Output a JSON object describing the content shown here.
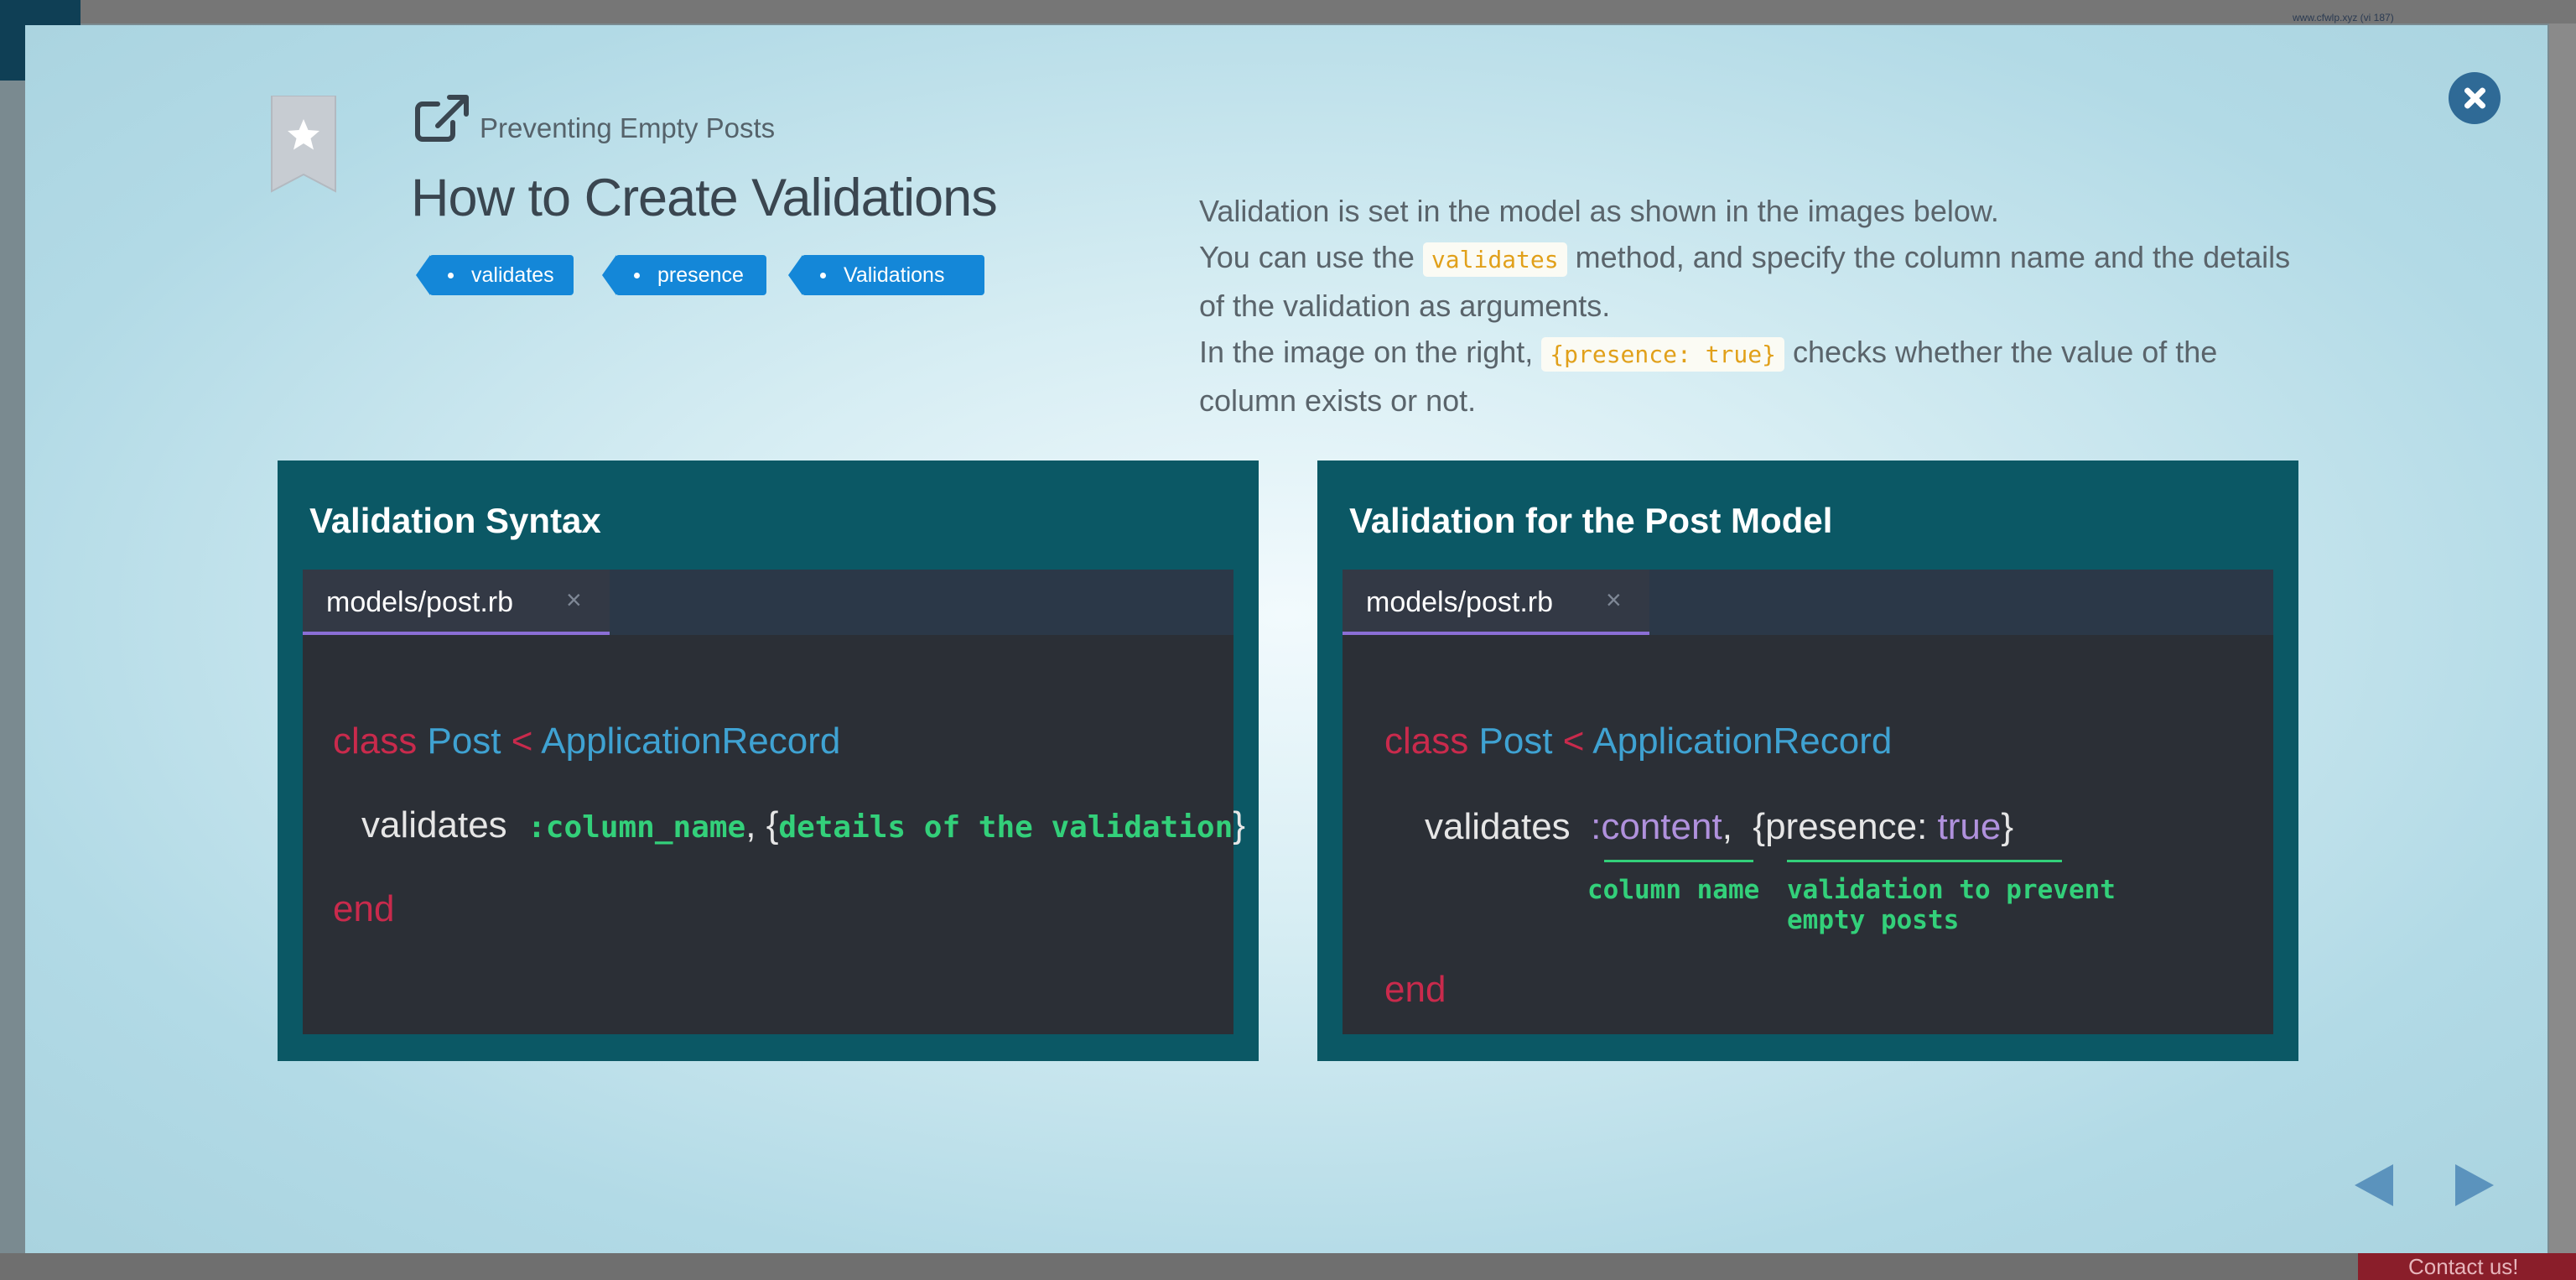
{
  "background_page": {
    "url_text": "www.cfwlp.xyz (vi 187)",
    "contact_label": "Contact us!"
  },
  "modal": {
    "subtitle": "Preventing Empty Posts",
    "title": "How to Create Validations",
    "tags": [
      "validates",
      "presence",
      "Validations"
    ],
    "description": {
      "line1": "Validation is set in the model as shown in the images below.",
      "line2_pre": "You can use the ",
      "line2_code": "validates",
      "line2_post": " method, and specify the column name and the details of the validation as arguments.",
      "line3_pre": "In the image on the right, ",
      "line3_code": "{presence: true}",
      "line3_post": " checks whether the value of the column exists or not."
    },
    "panels": [
      {
        "title": "Validation Syntax",
        "tab_label": "models/post.rb",
        "tab_close": "×",
        "code": {
          "kw_class": "class",
          "class_name": "Post",
          "lt": "<",
          "parent": "ApplicationRecord",
          "method": "validates",
          "arg1": ":column_name",
          "comma": ",",
          "brace_open": "{",
          "arg2": "details of the validation",
          "brace_close": "}",
          "kw_end": "end"
        }
      },
      {
        "title": "Validation for the Post Model",
        "tab_label": "models/post.rb",
        "tab_close": "×",
        "code": {
          "kw_class": "class",
          "class_name": "Post",
          "lt": "<",
          "parent": "ApplicationRecord",
          "method": "validates",
          "symbol": ":content",
          "comma": ",",
          "hash_open": "{presence: ",
          "value_true": "true",
          "hash_close": "}",
          "kw_end": "end",
          "note_column": "column name",
          "note_validation_1": "validation to prevent",
          "note_validation_2": "empty posts"
        }
      }
    ]
  },
  "colors": {
    "accent_blue": "#1487d8",
    "close_button": "#2f6a96",
    "panel_teal": "#0b5865",
    "code_green": "#33d07a",
    "keyword_red": "#c92a4c",
    "class_blue": "#3fa2d2",
    "symbol_purple": "#b091dd",
    "inline_code_yellow": "#e1a01a"
  },
  "icons": {
    "close": "close-icon",
    "bookmark": "bookmark-star-icon",
    "external": "external-link-icon",
    "prev": "triangle-left-icon",
    "next": "triangle-right-icon"
  }
}
